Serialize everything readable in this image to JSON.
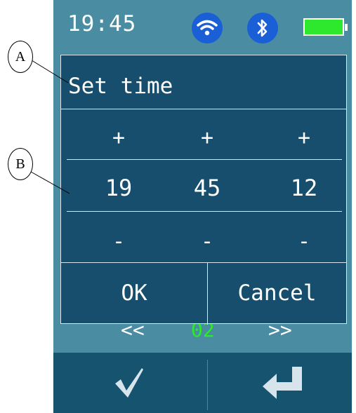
{
  "status": {
    "time": "19:45",
    "wifi_icon": "wifi-icon",
    "bluetooth_icon": "bluetooth-icon",
    "battery_icon": "battery-icon",
    "battery_color": "#2ee82e"
  },
  "background": {
    "prev_label": "<<",
    "page_number": "02",
    "next_label": ">>",
    "page_color": "#2ee82e"
  },
  "dialog": {
    "title": "Set time",
    "increment_label": "+",
    "decrement_label": "-",
    "hours": "19",
    "minutes": "45",
    "seconds": "12",
    "ok_label": "OK",
    "cancel_label": "Cancel"
  },
  "bottom_bar": {
    "confirm_icon": "check-icon",
    "back_icon": "return-arrow-icon"
  },
  "callouts": {
    "a": "A",
    "b": "B"
  }
}
